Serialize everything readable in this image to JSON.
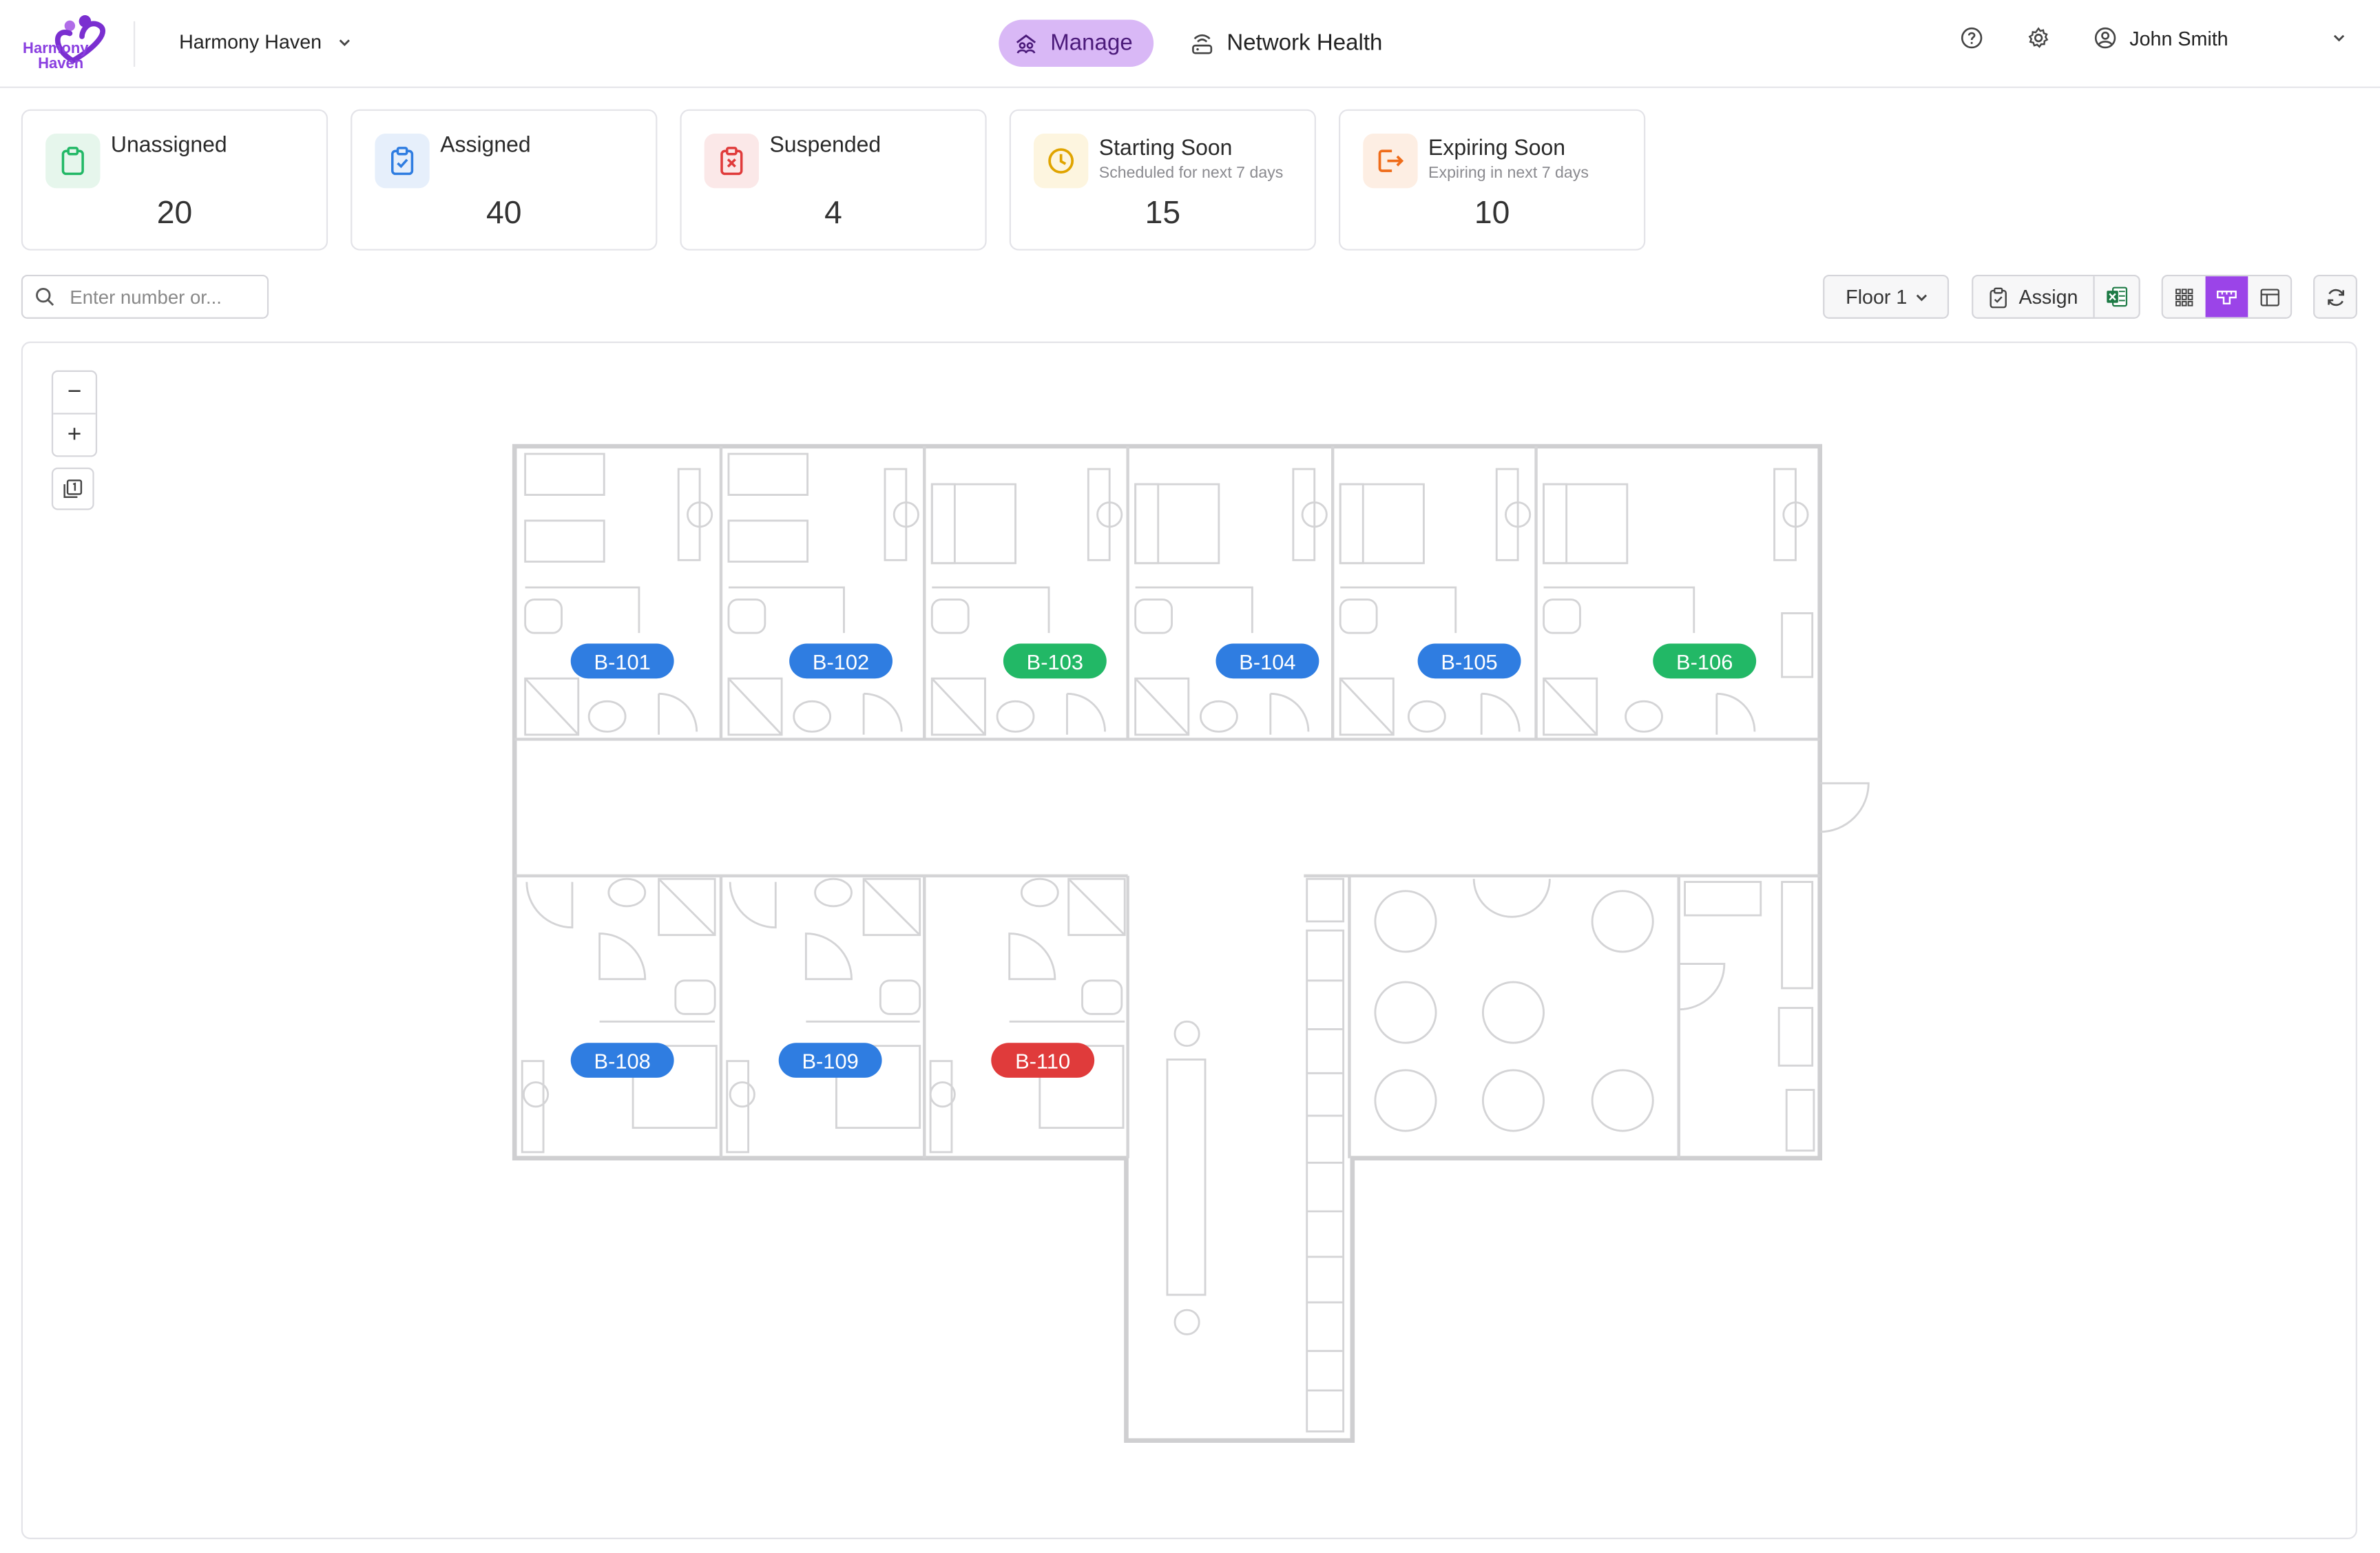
{
  "header": {
    "logo_text_line1": "Harmony",
    "logo_text_line2": "Haven",
    "property_name": "Harmony Haven",
    "nav": [
      {
        "label": "Manage",
        "icon": "manage-icon",
        "active": true
      },
      {
        "label": "Network Health",
        "icon": "router-icon",
        "active": false
      }
    ],
    "user_name": "John Smith",
    "icons": [
      "help-icon",
      "gear-icon",
      "user-circle-icon",
      "chevron-down-icon"
    ]
  },
  "stats": [
    {
      "title": "Unassigned",
      "subtitle": "",
      "count": "20",
      "icon": "clipboard-icon",
      "color": "#22b866",
      "bg": "#e6f6ec"
    },
    {
      "title": "Assigned",
      "subtitle": "",
      "count": "40",
      "icon": "clipboard-check-icon",
      "color": "#2f7de1",
      "bg": "#e6effb"
    },
    {
      "title": "Suspended",
      "subtitle": "",
      "count": "4",
      "icon": "clipboard-x-icon",
      "color": "#e03b3b",
      "bg": "#fbe8e8"
    },
    {
      "title": "Starting Soon",
      "subtitle": "Scheduled for next 7 days",
      "count": "15",
      "icon": "clock-icon",
      "color": "#e0a400",
      "bg": "#fdf5df"
    },
    {
      "title": "Expiring Soon",
      "subtitle": "Expiring in next 7 days",
      "count": "10",
      "icon": "exit-icon",
      "color": "#ef6c1a",
      "bg": "#fdeee3"
    }
  ],
  "toolbar": {
    "search_placeholder": "Enter number or...",
    "floor_label": "Floor 1",
    "assign_label": "Assign",
    "view_modes": [
      "grid-view-icon",
      "floorplan-view-icon",
      "table-view-icon"
    ],
    "active_view": "floorplan-view-icon"
  },
  "map": {
    "zoom_out": "−",
    "zoom_in": "+",
    "floor_toggle_icon": "floor-layers-icon",
    "rooms": [
      {
        "label": "B-101",
        "status": "assigned"
      },
      {
        "label": "B-102",
        "status": "assigned"
      },
      {
        "label": "B-103",
        "status": "unassigned"
      },
      {
        "label": "B-104",
        "status": "assigned"
      },
      {
        "label": "B-105",
        "status": "assigned"
      },
      {
        "label": "B-106",
        "status": "unassigned"
      },
      {
        "label": "B-108",
        "status": "assigned"
      },
      {
        "label": "B-109",
        "status": "assigned"
      },
      {
        "label": "B-110",
        "status": "suspended"
      }
    ],
    "status_colors": {
      "assigned": "#2f7de1",
      "unassigned": "#22b866",
      "suspended": "#e03b3b"
    }
  }
}
